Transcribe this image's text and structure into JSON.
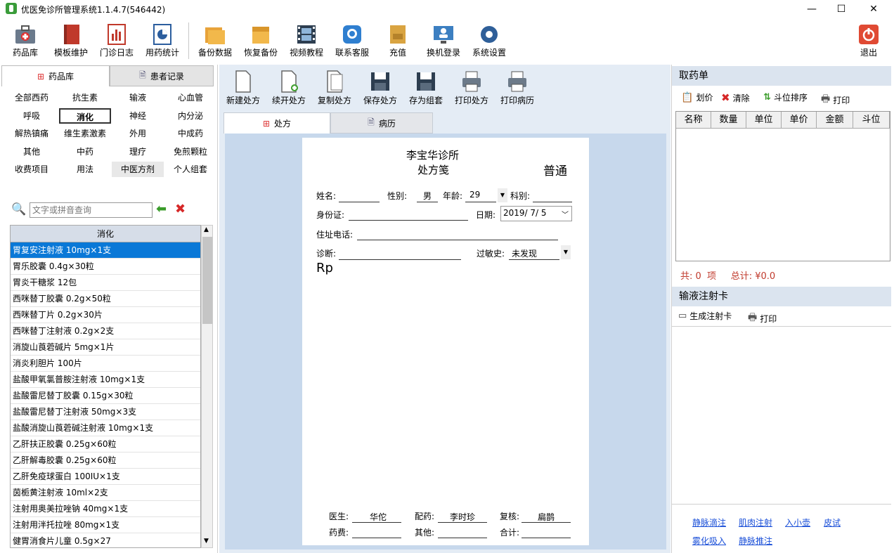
{
  "window": {
    "title": "优医免诊所管理系统1.1.4.7(546442)",
    "minimize": "—",
    "maximize": "☐",
    "close": "✕"
  },
  "toolbar": [
    {
      "label": "药品库",
      "icon": "medicine-box-icon"
    },
    {
      "label": "模板维护",
      "icon": "book-icon"
    },
    {
      "label": "门诊日志",
      "icon": "bar-chart-icon"
    },
    {
      "label": "用药统计",
      "icon": "pie-chart-icon"
    },
    {
      "label": "备份数据",
      "icon": "backup-folder-icon"
    },
    {
      "label": "恢复备份",
      "icon": "restore-box-icon"
    },
    {
      "label": "视频教程",
      "icon": "film-icon"
    },
    {
      "label": "联系客服",
      "icon": "support-icon"
    },
    {
      "label": "充值",
      "icon": "wallet-icon"
    },
    {
      "label": "换机登录",
      "icon": "monitor-login-icon"
    },
    {
      "label": "系统设置",
      "icon": "gear-icon"
    }
  ],
  "exit_label": "退出",
  "left": {
    "tabs": [
      "药品库",
      "患者记录"
    ],
    "categories": [
      "全部西药",
      "抗生素",
      "输液",
      "心血管",
      "呼吸",
      "消化",
      "神经",
      "内分泌",
      "解热镇痛",
      "维生素激素",
      "外用",
      "中成药",
      "其他",
      "中药",
      "理疗",
      "免煎颗粒",
      "收费项目",
      "用法",
      "中医方剂",
      "个人组套"
    ],
    "selected_category": "消化",
    "search_placeholder": "文字或拼音查询",
    "list_header": "消化",
    "drugs": [
      "胃复安注射液 10mg×1支",
      "胃乐胶囊 0.4g×30粒",
      "胃炎干糖浆 12包",
      "西咪替丁胶囊 0.2g×50粒",
      "西咪替丁片 0.2g×30片",
      "西咪替丁注射液 0.2g×2支",
      "消旋山莨菪碱片 5mg×1片",
      "消炎利胆片 100片",
      "盐酸甲氧氯普胺注射液 10mg×1支",
      "盐酸雷尼替丁胶囊 0.15g×30粒",
      "盐酸雷尼替丁注射液 50mg×3支",
      "盐酸消旋山莨菪碱注射液 10mg×1支",
      "乙肝扶正胶囊 0.25g×60粒",
      "乙肝解毒胶囊 0.25g×60粒",
      "乙肝免疫球蛋白 100IU×1支",
      "茵栀黄注射液 10ml×2支",
      "注射用奥美拉唑钠 40mg×1支",
      "注射用泮托拉唑 80mg×1支",
      "健胃消食片儿童 0.5g×27"
    ]
  },
  "center": {
    "toolbar": [
      "新建处方",
      "续开处方",
      "复制处方",
      "保存处方",
      "存为组套",
      "打印处方",
      "打印病历"
    ],
    "tabs": [
      "处方",
      "病历"
    ],
    "rx": {
      "clinic": "李宝华诊所",
      "doc_title": "处方笺",
      "rx_type": "普通",
      "name_label": "姓名:",
      "gender_label": "性别:",
      "gender": "男",
      "age_label": "年龄:",
      "age": "29",
      "dept_label": "科别:",
      "id_label": "身份证:",
      "date_label": "日期:",
      "date": "2019/ 7/ 5",
      "address_label": "住址电话:",
      "diagnosis_label": "诊断:",
      "allergy_label": "过敏史:",
      "allergy": "未发现",
      "rp": "Rp",
      "doctor_label": "医生:",
      "doctor": "华佗",
      "dispense_label": "配药:",
      "dispenser": "李时珍",
      "review_label": "复核:",
      "reviewer": "扁鹊",
      "fee_label": "药费:",
      "other_label": "其他:",
      "total_label": "合计:"
    }
  },
  "right": {
    "pick_title": "取药单",
    "pick_tools": [
      "划价",
      "清除",
      "斗位排序",
      "打印"
    ],
    "grid_columns": [
      "名称",
      "数量",
      "单位",
      "单价",
      "金额",
      "斗位"
    ],
    "summary": "共: 0  项     总计: ¥0.0",
    "infusion_title": "输液注射卡",
    "infusion_tools": [
      "生成注射卡",
      "打印"
    ],
    "links": [
      "静脉滴注",
      "肌肉注射",
      "入小壶",
      "皮试",
      "雾化吸入",
      "静脉推注"
    ]
  },
  "colors": {
    "selection": "#0a78d7",
    "panel_header": "#dbe4ef",
    "summary_red": "#c0392b",
    "link_blue": "#1a4fd8"
  }
}
